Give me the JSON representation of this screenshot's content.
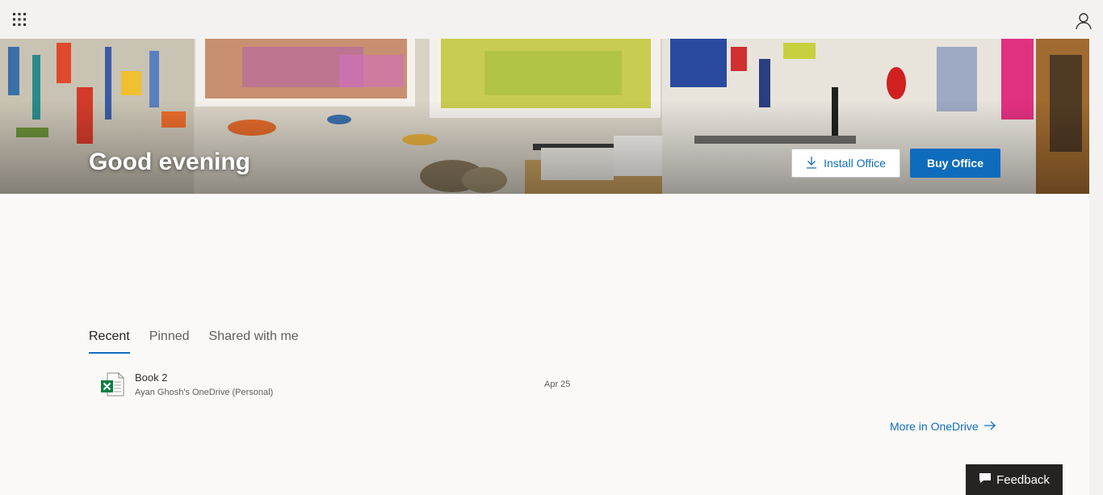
{
  "hero": {
    "greeting": "Good evening",
    "install_label": "Install Office",
    "buy_label": "Buy Office"
  },
  "tabs": [
    {
      "label": "Recent",
      "active": true
    },
    {
      "label": "Pinned",
      "active": false
    },
    {
      "label": "Shared with me",
      "active": false
    }
  ],
  "files": [
    {
      "name": "Book 2",
      "location": "Ayan Ghosh's OneDrive (Personal)",
      "date": "Apr 25",
      "icon": "excel-icon"
    }
  ],
  "more_link": "More in OneDrive",
  "feedback_label": "Feedback",
  "colors": {
    "accent": "#0f6cbd",
    "link": "#106ebe",
    "excel": "#107c41"
  }
}
